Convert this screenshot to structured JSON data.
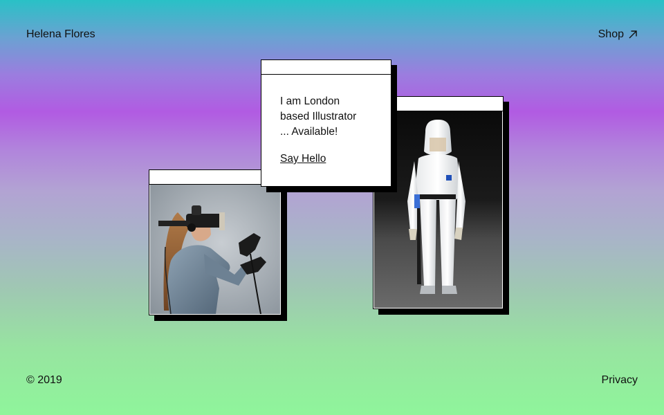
{
  "header": {
    "brand": "Helena Flores",
    "shop_label": "Shop",
    "shop_icon": "arrow-up-right-icon"
  },
  "intro_card": {
    "lines": [
      "I am London",
      "based Illustrator",
      "... Available!"
    ],
    "cta_label": "Say Hello"
  },
  "gallery": [
    {
      "subject": "woman-wearing-vr-headset-and-data-gloves"
    },
    {
      "subject": "person-in-white-protective-suit"
    }
  ],
  "footer": {
    "copyright": "© 2019",
    "privacy_label": "Privacy"
  },
  "colors": {
    "gradient_top": "#29c1c6",
    "gradient_purple": "#b15be2",
    "gradient_bottom": "#8ff59b",
    "ink": "#111111"
  }
}
